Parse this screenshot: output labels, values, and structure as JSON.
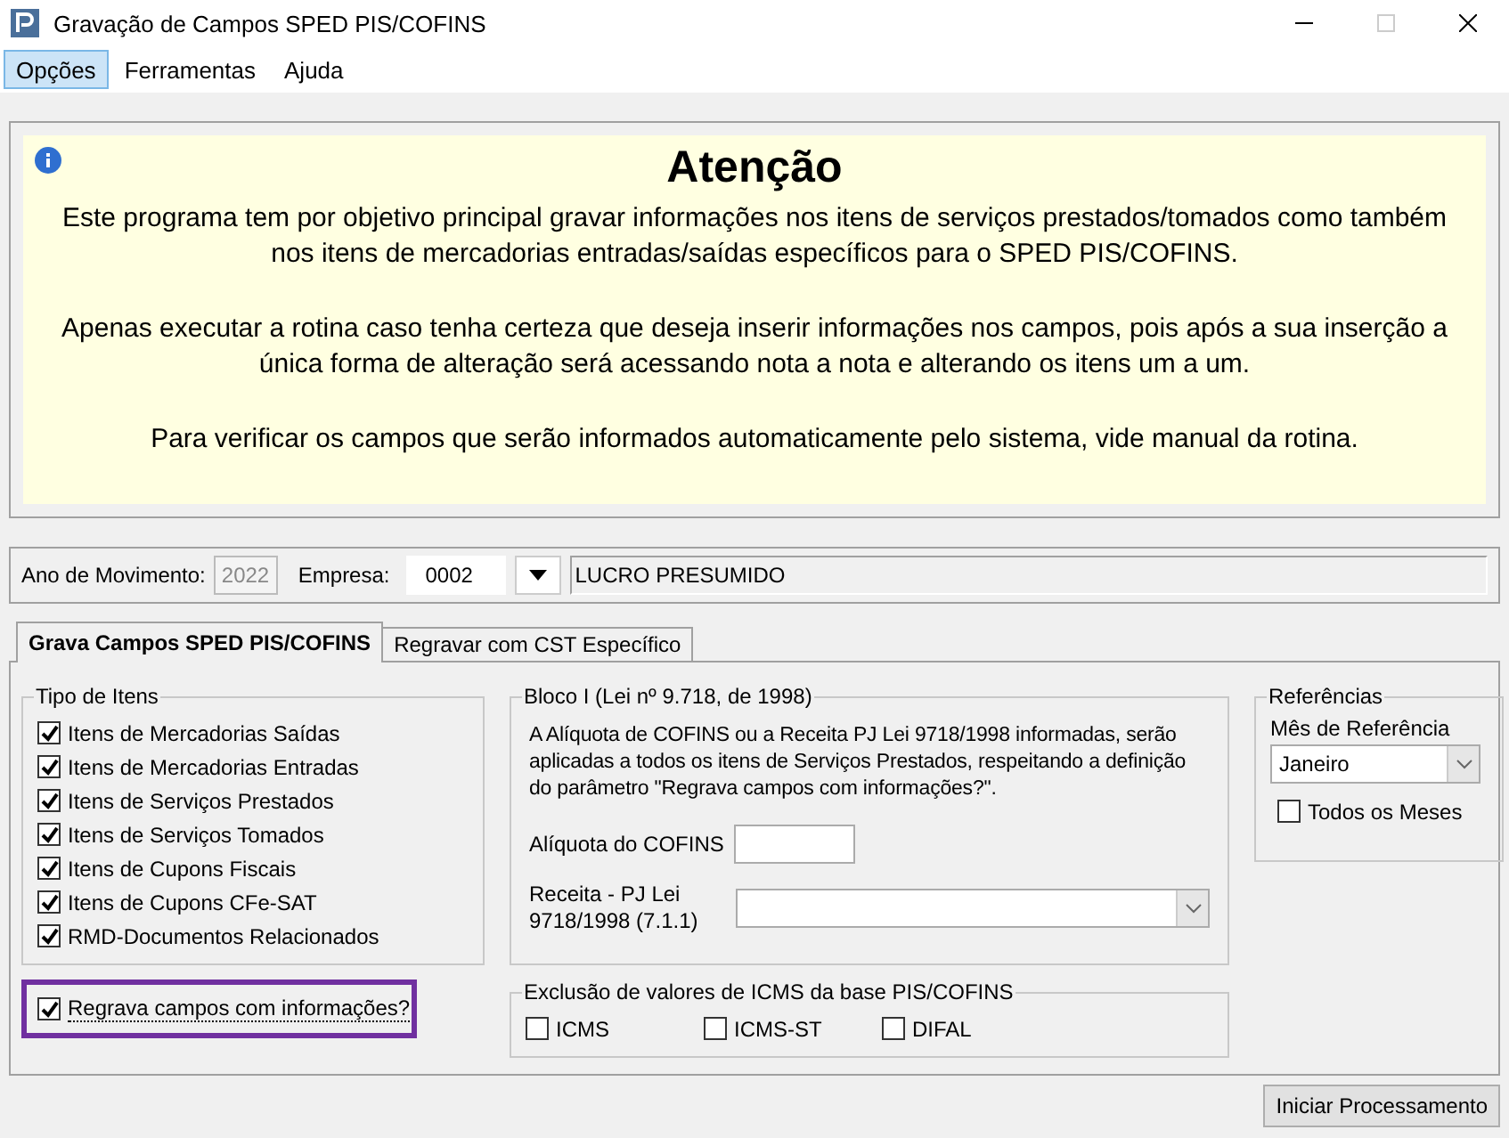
{
  "window": {
    "title": "Gravação de Campos SPED PIS/COFINS"
  },
  "menu": [
    {
      "label": "Opções",
      "selected": true
    },
    {
      "label": "Ferramentas",
      "selected": false
    },
    {
      "label": "Ajuda",
      "selected": false
    }
  ],
  "notice": {
    "heading": "Atenção",
    "paragraphs": [
      "Este programa tem por objetivo principal gravar informações nos itens de serviços prestados/tomados como também nos itens de mercadorias entradas/saídas específicos para o SPED PIS/COFINS.",
      "Apenas executar a rotina caso tenha certeza que deseja inserir informações nos campos, pois após a sua inserção a única forma de alteração será acessando nota a nota e alterando os itens um a um.",
      "Para verificar os campos que serão informados automaticamente pelo sistema, vide manual da rotina."
    ]
  },
  "filters": {
    "year_label": "Ano de Movimento:",
    "year": "2022",
    "company_label": "Empresa:",
    "company_code": "0002",
    "company_name": "LUCRO PRESUMIDO"
  },
  "tabs": [
    {
      "label": "Grava Campos SPED PIS/COFINS",
      "selected": true
    },
    {
      "label": "Regravar com CST Específico",
      "selected": false
    }
  ],
  "item_types": {
    "title": "Tipo de Itens",
    "items": [
      {
        "label": "Itens de Mercadorias Saídas",
        "checked": true
      },
      {
        "label": "Itens de Mercadorias Entradas",
        "checked": true
      },
      {
        "label": "Itens de Serviços Prestados",
        "checked": true
      },
      {
        "label": "Itens de Serviços Tomados",
        "checked": true
      },
      {
        "label": "Itens de Cupons Fiscais",
        "checked": true
      },
      {
        "label": "Itens de Cupons CFe-SAT",
        "checked": true
      },
      {
        "label": "RMD-Documentos Relacionados",
        "checked": true
      }
    ]
  },
  "rewrite": {
    "label": "Regrava campos com informações?",
    "checked": true,
    "highlighted": true
  },
  "bloco": {
    "title": "Bloco I (Lei nº 9.718, de 1998)",
    "description": "A Alíquota de COFINS ou a Receita PJ Lei 9718/1998 informadas, serão aplicadas a todos os itens de Serviços Prestados, respeitando a definição do parâmetro \"Regrava campos com informações?\".",
    "rate_label": "Alíquota do COFINS",
    "revenue_label": "Receita - PJ Lei 9718/1998 (7.1.1)"
  },
  "icms_exclusion": {
    "title": "Exclusão de valores de ICMS da base PIS/COFINS",
    "options": [
      {
        "label": "ICMS",
        "checked": false
      },
      {
        "label": "ICMS-ST",
        "checked": false
      },
      {
        "label": "DIFAL",
        "checked": false
      }
    ]
  },
  "references": {
    "title": "Referências",
    "month_label": "Mês de Referência",
    "month": "Janeiro",
    "all_months": {
      "label": "Todos os Meses",
      "checked": false
    }
  },
  "buttons": [
    {
      "label": "Iniciar Processamento"
    }
  ]
}
